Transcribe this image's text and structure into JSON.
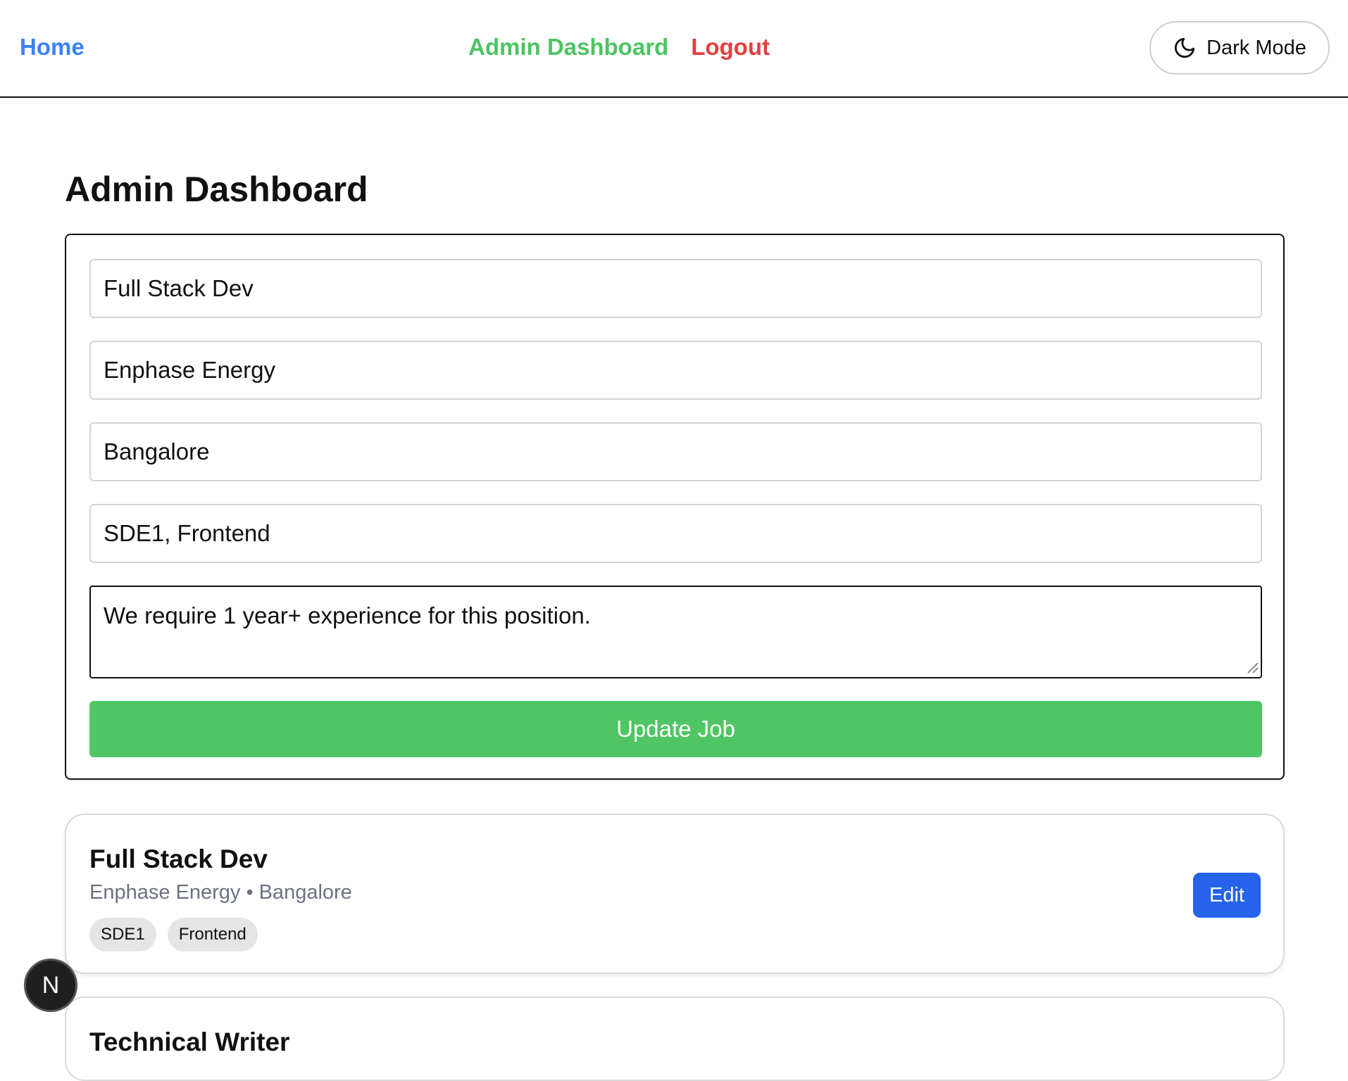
{
  "nav": {
    "home": "Home",
    "admin": "Admin Dashboard",
    "logout": "Logout",
    "dark_mode": "Dark Mode",
    "dark_mode_icon": "moon-icon"
  },
  "page_title": "Admin Dashboard",
  "form": {
    "title_value": "Full Stack Dev",
    "company_value": "Enphase Energy",
    "location_value": "Bangalore",
    "tags_value": "SDE1, Frontend",
    "description_value": "We require 1 year+ experience for this position.",
    "submit_label": "Update Job"
  },
  "jobs": [
    {
      "title": "Full Stack Dev",
      "company": "Enphase Energy",
      "separator": "•",
      "location": "Bangalore",
      "tags": [
        "SDE1",
        "Frontend"
      ],
      "edit_label": "Edit"
    },
    {
      "title": "Technical Writer"
    }
  ],
  "dev_badge": "N",
  "colors": {
    "home_link": "#3b82f6",
    "admin_link": "#4cc462",
    "logout_link": "#e53e3e",
    "update_button": "#4fc663",
    "edit_button": "#2563eb",
    "meta_text": "#6b7280"
  }
}
